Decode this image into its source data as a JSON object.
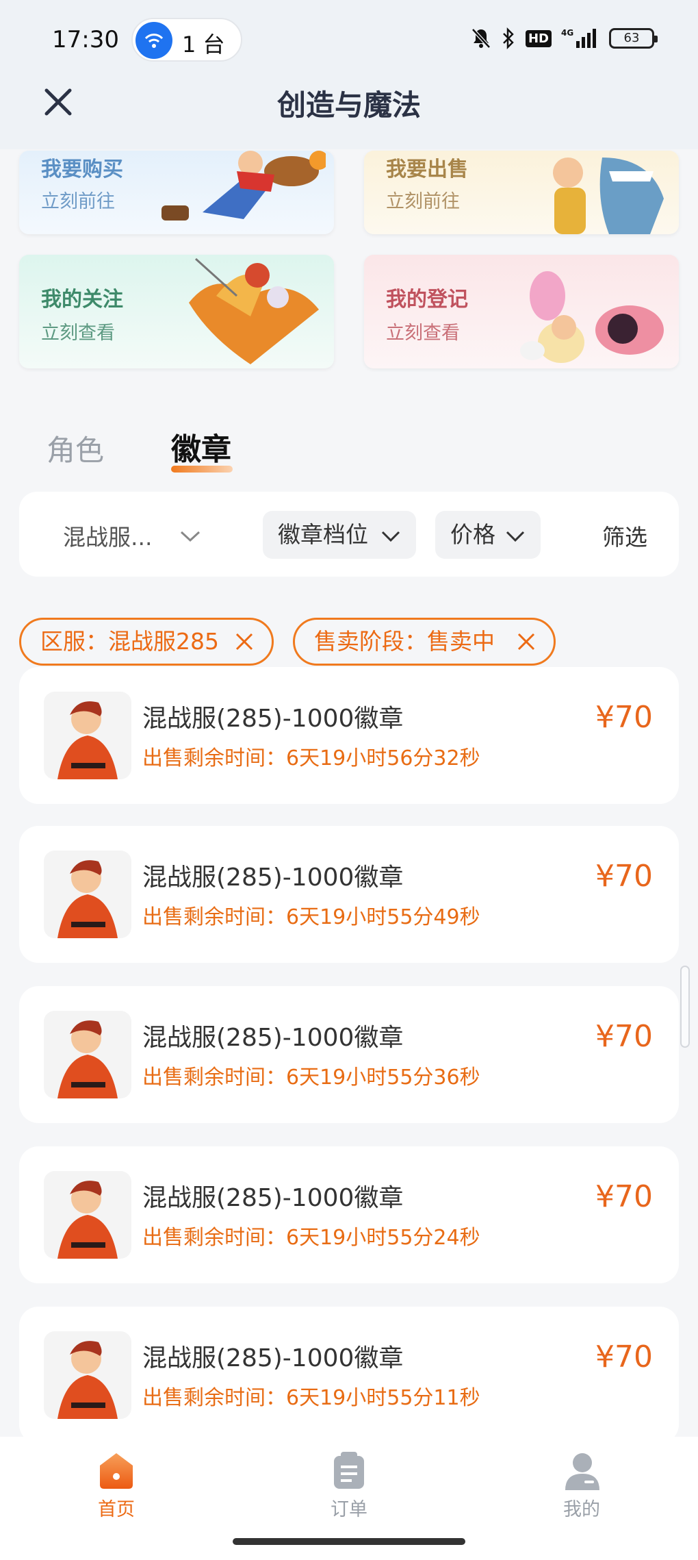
{
  "status_bar": {
    "time": "17:30",
    "hotspot_count": "1 台",
    "battery": "63",
    "icons": [
      "bell-off-icon",
      "bluetooth-icon",
      "hd-icon",
      "4g-signal-icon",
      "battery-icon"
    ]
  },
  "header": {
    "title": "创造与魔法",
    "close_icon": "close-icon"
  },
  "quick_cards": [
    {
      "title": "我要购买",
      "subtitle": "立刻前往",
      "color": "#5a8fc4"
    },
    {
      "title": "我要出售",
      "subtitle": "立刻前往",
      "color": "#a8854a"
    },
    {
      "title": "我的关注",
      "subtitle": "立刻查看",
      "color": "#3e8a6a"
    },
    {
      "title": "我的登记",
      "subtitle": "立刻查看",
      "color": "#c0525e"
    }
  ],
  "tabs": [
    {
      "label": "角色",
      "active": false
    },
    {
      "label": "徽章",
      "active": true
    }
  ],
  "filters": {
    "server": "混战服...",
    "tier": "徽章档位",
    "price": "价格",
    "screen": "筛选"
  },
  "active_tags": [
    {
      "label": "区服：混战服285"
    },
    {
      "label": "售卖阶段：售卖中"
    }
  ],
  "listings": [
    {
      "title": "混战服(285)-1000徽章",
      "time_label": "出售剩余时间：",
      "time_value": "6天19小时56分32秒",
      "price": "¥70"
    },
    {
      "title": "混战服(285)-1000徽章",
      "time_label": "出售剩余时间：",
      "time_value": "6天19小时55分49秒",
      "price": "¥70"
    },
    {
      "title": "混战服(285)-1000徽章",
      "time_label": "出售剩余时间：",
      "time_value": "6天19小时55分36秒",
      "price": "¥70"
    },
    {
      "title": "混战服(285)-1000徽章",
      "time_label": "出售剩余时间：",
      "time_value": "6天19小时55分24秒",
      "price": "¥70"
    },
    {
      "title": "混战服(285)-1000徽章",
      "time_label": "出售剩余时间：",
      "time_value": "6天19小时55分11秒",
      "price": "¥70"
    }
  ],
  "bottom_nav": [
    {
      "label": "首页",
      "active": true
    },
    {
      "label": "订单",
      "active": false
    },
    {
      "label": "我的",
      "active": false
    }
  ],
  "colors": {
    "accent": "#ec6a14",
    "active_nav": "#ec6a14",
    "inactive_nav": "#9aa0a8"
  }
}
